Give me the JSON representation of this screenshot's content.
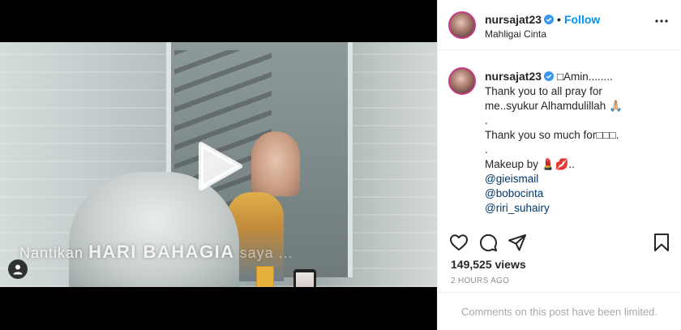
{
  "video": {
    "caption_light": "Nantikan",
    "caption_strong": "HARI BAHAGIA",
    "caption_fade": "saya ..."
  },
  "post": {
    "username": "nursajat23",
    "follow_separator": "•",
    "follow_label": "Follow",
    "location": "Mahligai Cinta"
  },
  "caption": {
    "username": "nursajat23",
    "first_line": "□Amin........",
    "lines": [
      "Thank you to all pray for",
      "me..syukur Alhamdulillah 🙏🏼",
      ".",
      "Thank you so much for□□□.",
      ".",
      "Makeup by 💄💋.."
    ],
    "mentions": [
      "@gieismail",
      "@bobocinta",
      "@riri_suhairy"
    ],
    "trailing": [
      ".",
      "."
    ]
  },
  "stats": {
    "views": "149,525 views",
    "time": "2 HOURS AGO"
  },
  "comments_notice": "Comments on this post have been limited.",
  "colors": {
    "accent": "#0095f6",
    "mention": "#00376b",
    "text": "#262626",
    "muted": "#8e8e8e",
    "story_ring": "#c73a86"
  },
  "icons": {
    "actions": [
      "heart-icon",
      "comment-icon",
      "share-icon",
      "bookmark-icon"
    ],
    "video": [
      "play-icon",
      "user-tag-icon"
    ],
    "header": [
      "verified-badge-icon",
      "more-options-icon"
    ]
  }
}
